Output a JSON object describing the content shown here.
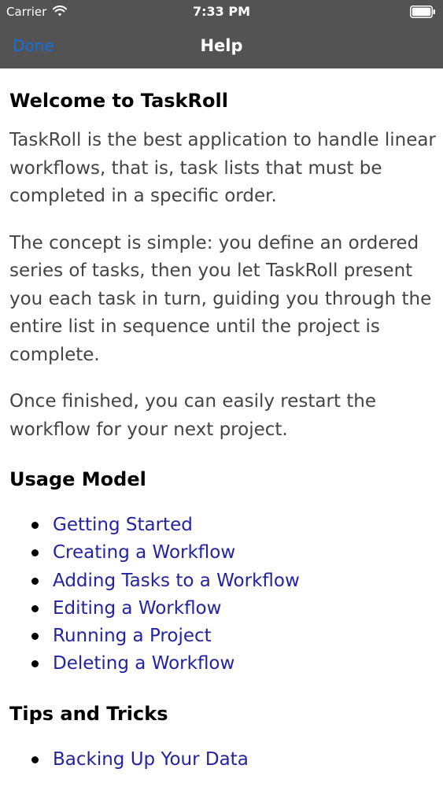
{
  "status_bar": {
    "carrier": "Carrier",
    "time": "7:33 PM",
    "wifi_icon": "wifi-icon",
    "battery_icon": "battery-icon"
  },
  "nav_bar": {
    "done_label": "Done",
    "title": "Help",
    "background_color": "#535353",
    "accent_color": "#1470d8"
  },
  "content": {
    "welcome_heading": "Welcome to TaskRoll",
    "paragraphs": [
      "TaskRoll is the best application to handle linear workflows, that is, task lists that must be completed in a specific order.",
      "The concept is simple: you define an ordered series of tasks, then you let TaskRoll present you each task in turn, guiding you through the entire list in sequence until the project is complete.",
      "Once finished, you can easily restart the workflow for your next project."
    ],
    "usage_heading": "Usage Model",
    "usage_links": [
      "Getting Started",
      "Creating a Workflow",
      "Adding Tasks to a Workflow",
      "Editing a Workflow",
      "Running a Project",
      "Deleting a Workflow"
    ],
    "tips_heading": "Tips and Tricks",
    "tips_links": [
      "Backing Up Your Data"
    ],
    "link_color": "#2323a0"
  }
}
